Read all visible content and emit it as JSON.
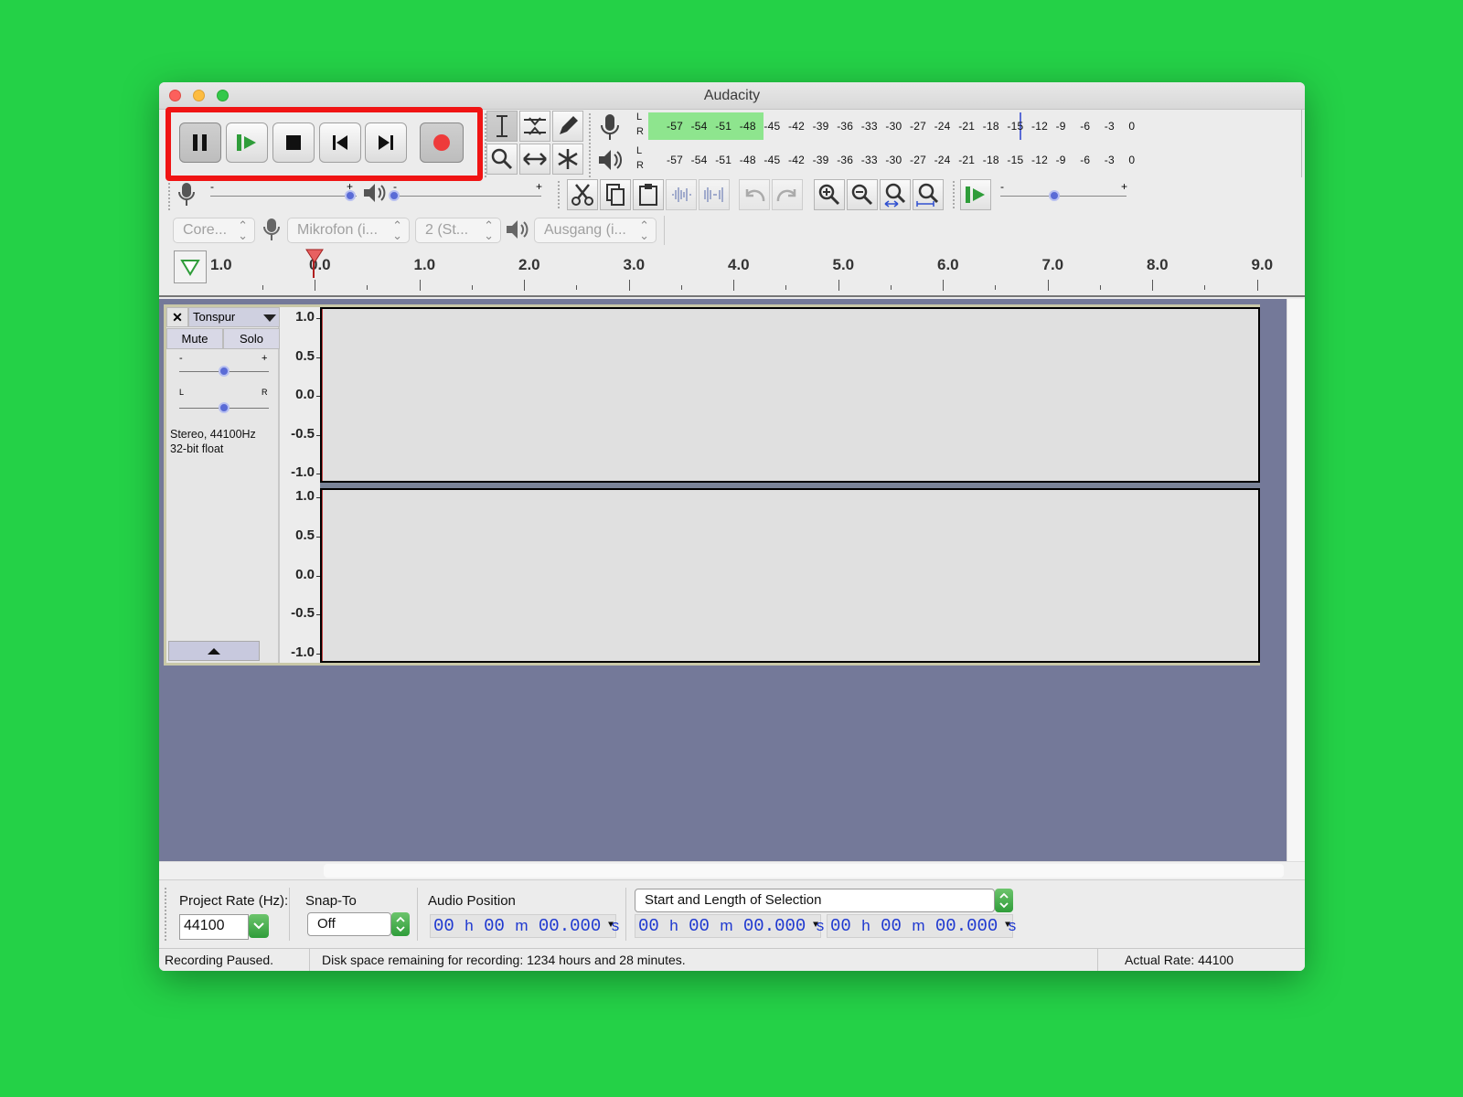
{
  "window": {
    "title": "Audacity"
  },
  "colors": {
    "background": "#24d147",
    "highlight": "#f01414",
    "timecode": "#1e38d0",
    "track_bg": "#747999"
  },
  "meters": {
    "rec_scale": [
      "-57",
      "-54",
      "-51",
      "-48",
      "-45",
      "-42",
      "-39",
      "-36",
      "-33",
      "-30",
      "-27",
      "-24",
      "-21",
      "-18",
      "-15",
      "-12",
      "-9",
      "-6",
      "-3",
      "0"
    ],
    "play_scale": [
      "-57",
      "-54",
      "-51",
      "-48",
      "-45",
      "-42",
      "-39",
      "-36",
      "-33",
      "-30",
      "-27",
      "-24",
      "-21",
      "-18",
      "-15",
      "-12",
      "-9",
      "-6",
      "-3",
      "0"
    ],
    "channel_l": "L",
    "channel_r": "R"
  },
  "sliders": {
    "rec_minus": "-",
    "rec_plus": "+",
    "play_minus": "-",
    "play_plus": "+",
    "speed_minus": "-",
    "speed_plus": "+"
  },
  "devices": {
    "host": "Core...",
    "input": "Mikrofon (i...",
    "channels": "2 (St...",
    "output": "Ausgang (i..."
  },
  "ruler": {
    "left_label": "1.0",
    "ticks": [
      "0.0",
      "1.0",
      "2.0",
      "3.0",
      "4.0",
      "5.0",
      "6.0",
      "7.0",
      "8.0",
      "9.0"
    ]
  },
  "track": {
    "name": "Tonspur",
    "mute": "Mute",
    "solo": "Solo",
    "gain_minus": "-",
    "gain_plus": "+",
    "pan_left": "L",
    "pan_right": "R",
    "info_line1": "Stereo, 44100Hz",
    "info_line2": "32-bit float",
    "y_axis": [
      "1.0",
      "0.5",
      "0.0",
      "-0.5",
      "-1.0"
    ]
  },
  "selection_bar": {
    "rate_label": "Project Rate (Hz):",
    "rate_value": "44100",
    "snap_label": "Snap-To",
    "snap_value": "Off",
    "position_label": "Audio Position",
    "selection_mode": "Start and Length of Selection",
    "time_hh": "00",
    "time_h": "h",
    "time_mm": "00",
    "time_m": "m",
    "time_ss": "00.000",
    "time_s": "s"
  },
  "status": {
    "state": "Recording Paused.",
    "disk": "Disk space remaining for recording: 1234 hours and 28 minutes.",
    "rate": "Actual Rate: 44100"
  }
}
